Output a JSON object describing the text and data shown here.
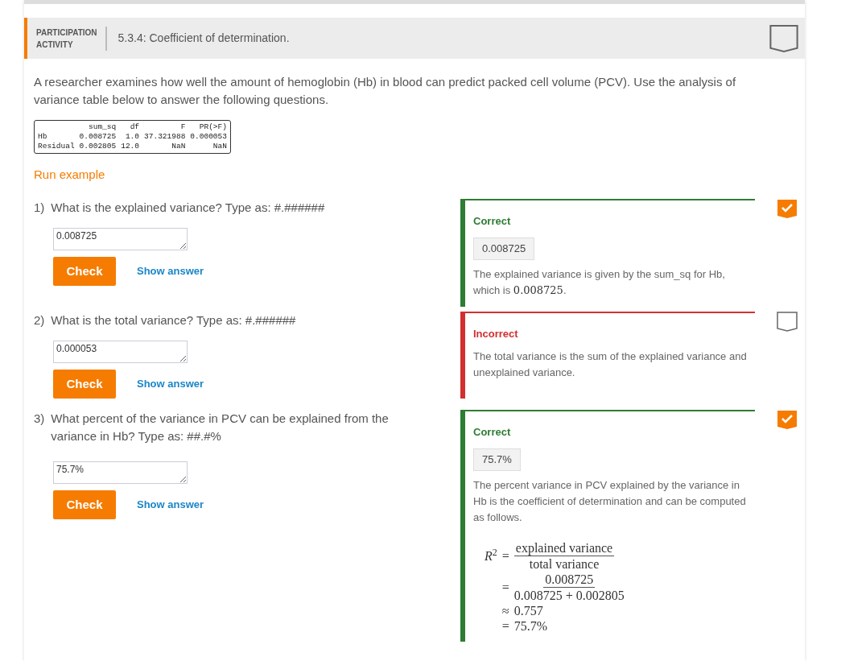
{
  "header": {
    "label_line1": "PARTICIPATION",
    "label_line2": "ACTIVITY",
    "title": "5.3.4: Coefficient of determination.",
    "completed": false
  },
  "intro": "A researcher examines how well the amount of hemoglobin (Hb) in blood can predict packed cell volume (PCV). Use the analysis of variance table below to answer the following questions.",
  "anova_table": {
    "columns": [
      "sum_sq",
      "df",
      "F",
      "PR(>F)"
    ],
    "rows": [
      {
        "label": "Hb",
        "cells": [
          "0.008725",
          "1.0",
          "37.321988",
          "0.000053"
        ]
      },
      {
        "label": "Residual",
        "cells": [
          "0.002805",
          "12.0",
          "NaN",
          "NaN"
        ]
      }
    ]
  },
  "run_example": "Run example",
  "questions": [
    {
      "number": "1)",
      "text": "What is the explained variance? Type as: #.######",
      "answer": "0.008725",
      "check": "Check",
      "show_answer": "Show answer",
      "completed": true,
      "feedback": {
        "correct": true,
        "label": "Correct",
        "answer": "0.008725",
        "explanation": "The explained variance is given by the sum_sq for Hb, which is **0.008725**."
      }
    },
    {
      "number": "2)",
      "text": "What is the total variance? Type as: #.######",
      "answer": "0.000053",
      "check": "Check",
      "show_answer": "Show answer",
      "completed": false,
      "feedback": {
        "correct": false,
        "label": "Incorrect",
        "explanation": "The total variance is the sum of the explained variance and unexplained variance."
      }
    },
    {
      "number": "3)",
      "text": "What percent of the variance in PCV can be explained from the variance in Hb? Type as: ##.#%",
      "answer": "75.7%",
      "check": "Check",
      "show_answer": "Show answer",
      "completed": true,
      "feedback": {
        "correct": true,
        "label": "Correct",
        "answer": "75.7%",
        "explanation": "The percent variance in PCV explained by the variance in Hb is the coefficient of determination and can be computed as follows.",
        "formula": [
          {
            "kind": "fraction",
            "lhs": "*R*$^{2}$",
            "op": "=",
            "numerator": "explained variance",
            "denominator": "total variance"
          },
          {
            "kind": "fraction",
            "op": "=",
            "numerator": "0.008725",
            "denominator": "0.008725 + 0.002805"
          },
          {
            "kind": "plain",
            "op": "≈",
            "value": "0.757"
          },
          {
            "kind": "plain",
            "op": "=",
            "value": "75.7%"
          }
        ]
      }
    }
  ]
}
